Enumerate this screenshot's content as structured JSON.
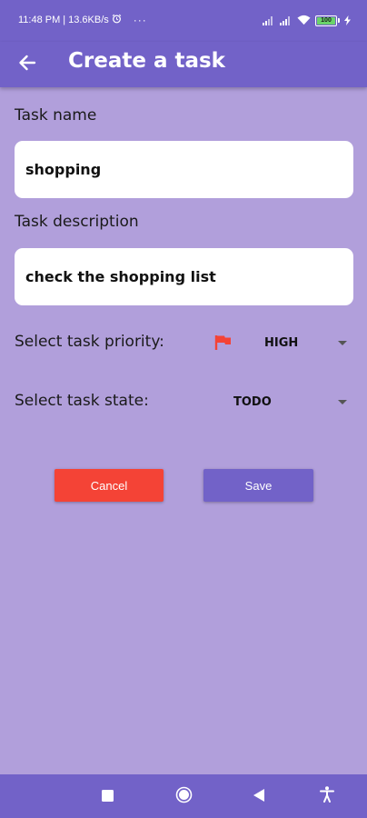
{
  "status_bar": {
    "time": "11:48 PM",
    "separator": "|",
    "network_speed": "13.6KB/s",
    "more_dots": "···",
    "battery_level": "100"
  },
  "app_bar": {
    "title": "Create a task"
  },
  "form": {
    "task_name_label": "Task name",
    "task_name_value": "shopping",
    "task_description_label": "Task description",
    "task_description_value": "check the shopping list",
    "priority_label": "Select task priority:",
    "priority_value": "HIGH",
    "state_label": "Select task state:",
    "state_value": "TODO"
  },
  "actions": {
    "cancel_label": "Cancel",
    "save_label": "Save"
  },
  "colors": {
    "background": "#b19fdb",
    "primary": "#7262c8",
    "cancel": "#f44336",
    "priority_flag": "#f44336"
  },
  "icons": {
    "back": "arrow-back-icon",
    "priority_flag": "flag-icon",
    "nav_recents": "square-icon",
    "nav_home": "circle-icon",
    "nav_back": "triangle-back-icon",
    "nav_accessibility": "accessibility-icon"
  }
}
